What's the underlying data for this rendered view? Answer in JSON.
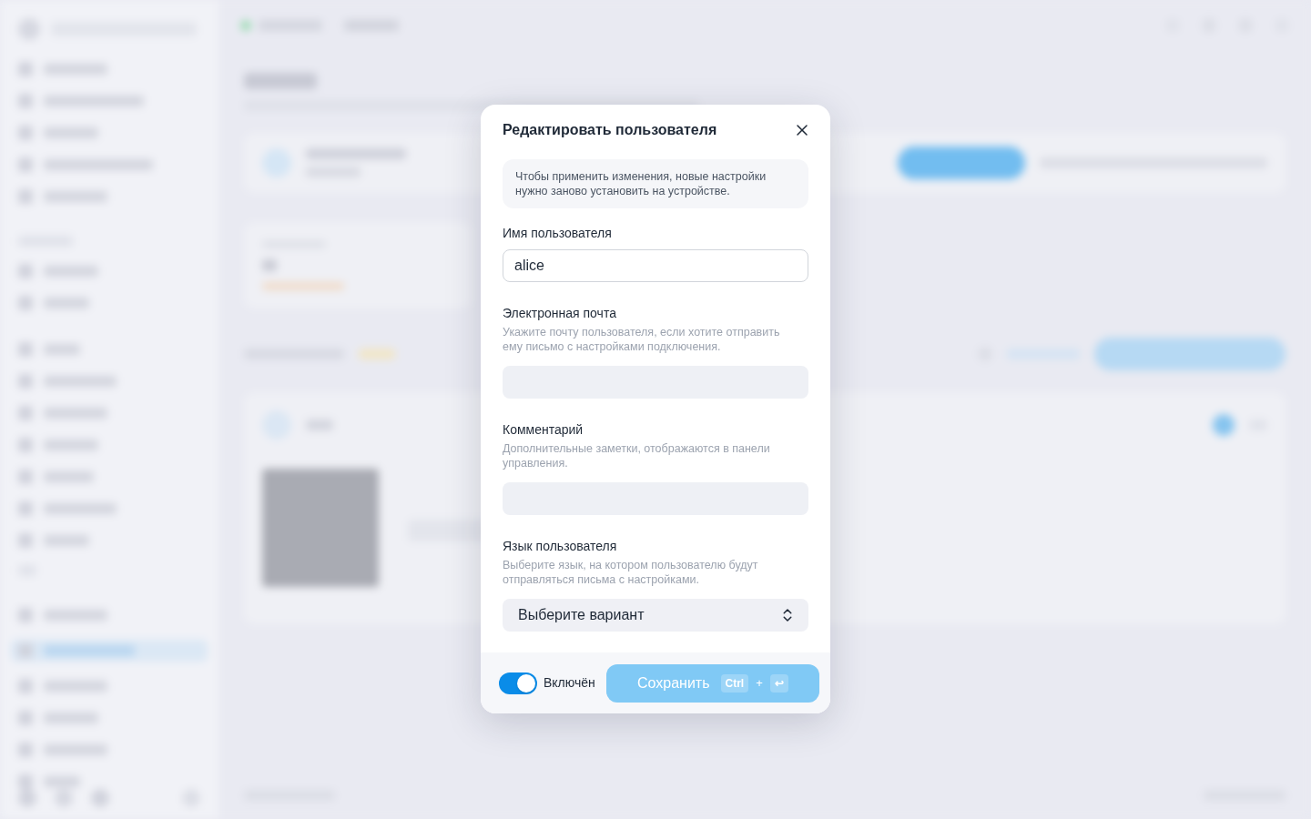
{
  "dialog": {
    "title": "Редактировать пользователя",
    "notice": "Чтобы применить изменения, новые настройки нужно заново установить на устройстве.",
    "fields": [
      {
        "kind": "text",
        "label": "Имя пользователя",
        "value": "alice"
      },
      {
        "kind": "text",
        "label": "Электронная почта",
        "description": "Укажите почту пользователя, если хотите отправить ему письмо с настройками подключения."
      },
      {
        "kind": "text",
        "label": "Комментарий",
        "description": "Дополнительные заметки, отображаются в панели управления."
      },
      {
        "kind": "select",
        "label": "Язык пользователя",
        "description": "Выберите язык, на котором пользователю будут отправляться письма с настройками.",
        "placeholder": "Выберите вариант"
      }
    ],
    "status_toggle": {
      "label": "Включён",
      "on": true
    },
    "save_button": {
      "label": "Сохранить",
      "disabled": true,
      "shortcut": {
        "keys": [
          "Ctrl",
          "↩"
        ],
        "separator": "+"
      }
    }
  }
}
